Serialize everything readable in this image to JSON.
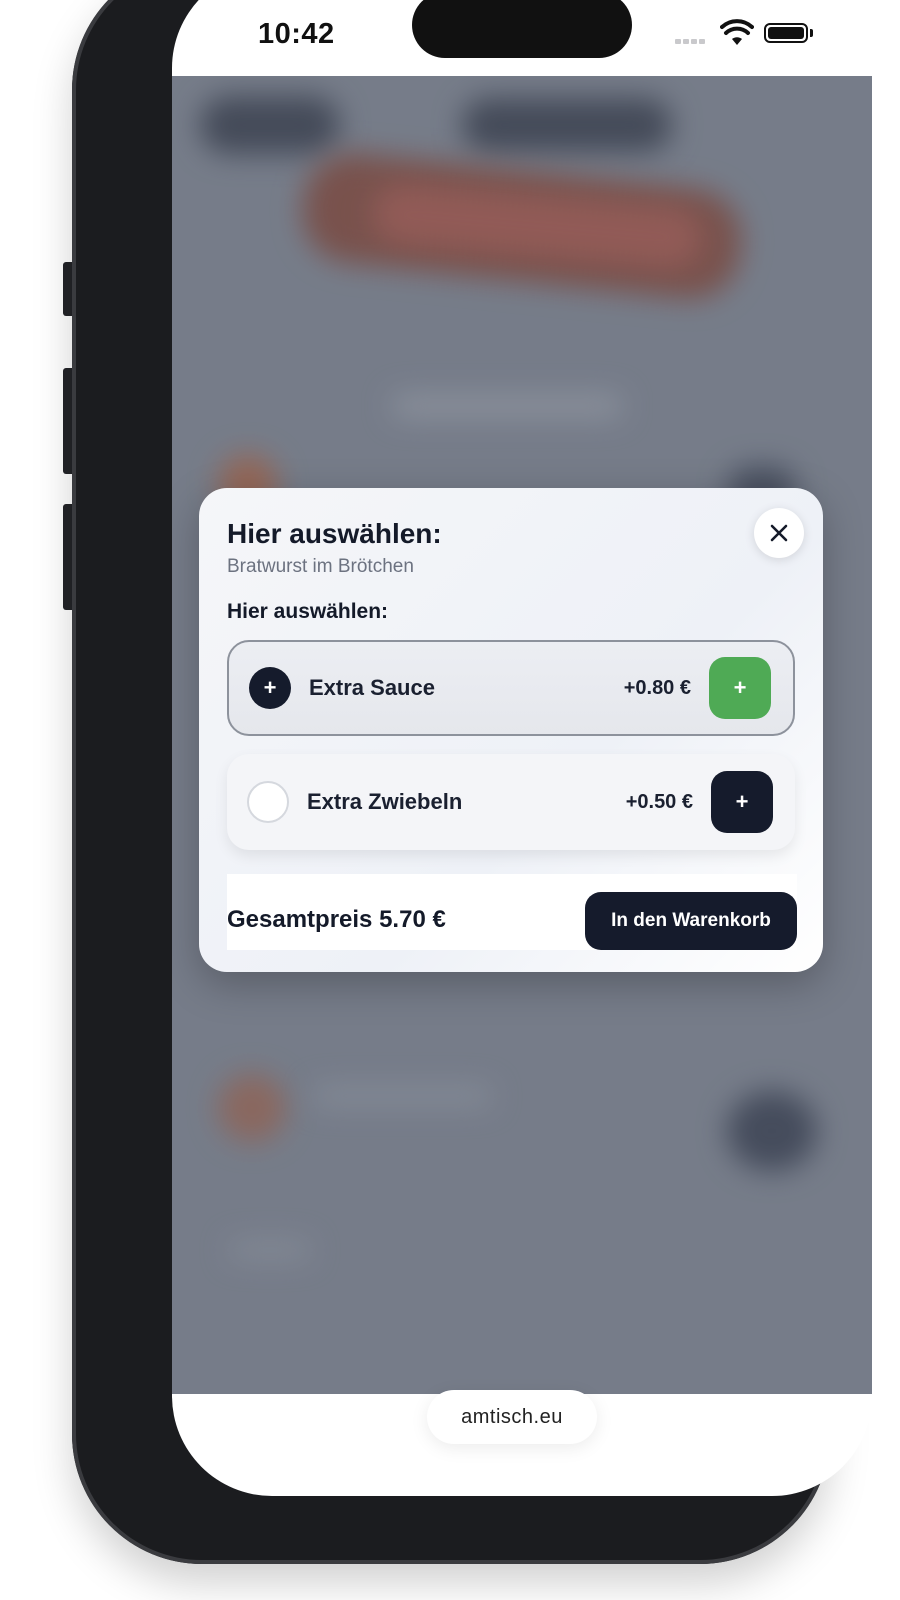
{
  "status_bar": {
    "time": "10:42"
  },
  "modal": {
    "title": "Hier auswählen:",
    "subtitle": "Bratwurst im Brötchen",
    "section_label": "Hier auswählen:",
    "close_icon": "close-icon",
    "options": [
      {
        "name": "Extra Sauce",
        "price": "+0.80 €",
        "selected": true,
        "radio_symbol": "+",
        "add_symbol": "+",
        "add_color": "#4faa55"
      },
      {
        "name": "Extra Zwiebeln",
        "price": "+0.50 €",
        "selected": false,
        "radio_symbol": "",
        "add_symbol": "+",
        "add_color": "#151b2c"
      }
    ],
    "total": "Gesamtpreis 5.70 €",
    "cart_button": "In den Warenkorb"
  },
  "browser": {
    "url": "amtisch.eu"
  },
  "colors": {
    "accent_dark": "#151b2c",
    "accent_green": "#4faa55",
    "overlay": "#868b97"
  }
}
